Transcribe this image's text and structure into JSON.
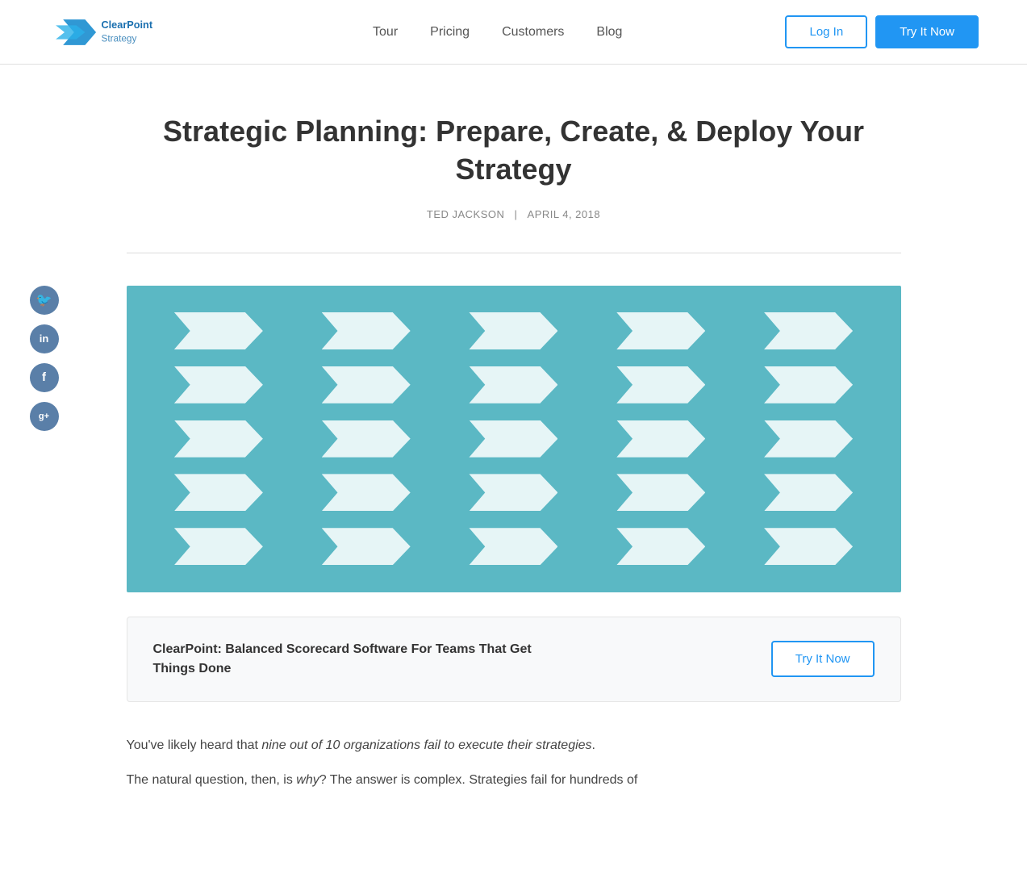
{
  "header": {
    "logo_alt": "ClearPoint Strategy",
    "nav": {
      "tour_label": "Tour",
      "pricing_label": "Pricing",
      "customers_label": "Customers",
      "blog_label": "Blog"
    },
    "login_label": "Log In",
    "try_label": "Try It Now"
  },
  "article": {
    "title": "Strategic Planning: Prepare, Create, & Deploy Your Strategy",
    "author": "TED JACKSON",
    "date": "APRIL 4, 2018",
    "meta_separator": "|",
    "cta": {
      "text": "ClearPoint: Balanced Scorecard Software For Teams That Get Things Done",
      "button_label": "Try It Now"
    },
    "body_intro_1": "You've likely heard that ",
    "body_intro_italic": "nine out of 10 organizations fail to execute their strategies",
    "body_intro_end": ".",
    "body_2_start": "The natural question, then, is ",
    "body_2_italic": "why",
    "body_2_end": "? The answer is complex. Strategies fail for hundreds of"
  },
  "social": {
    "twitter_icon": "𝕏",
    "linkedin_icon": "in",
    "facebook_icon": "f",
    "googleplus_icon": "g+"
  }
}
